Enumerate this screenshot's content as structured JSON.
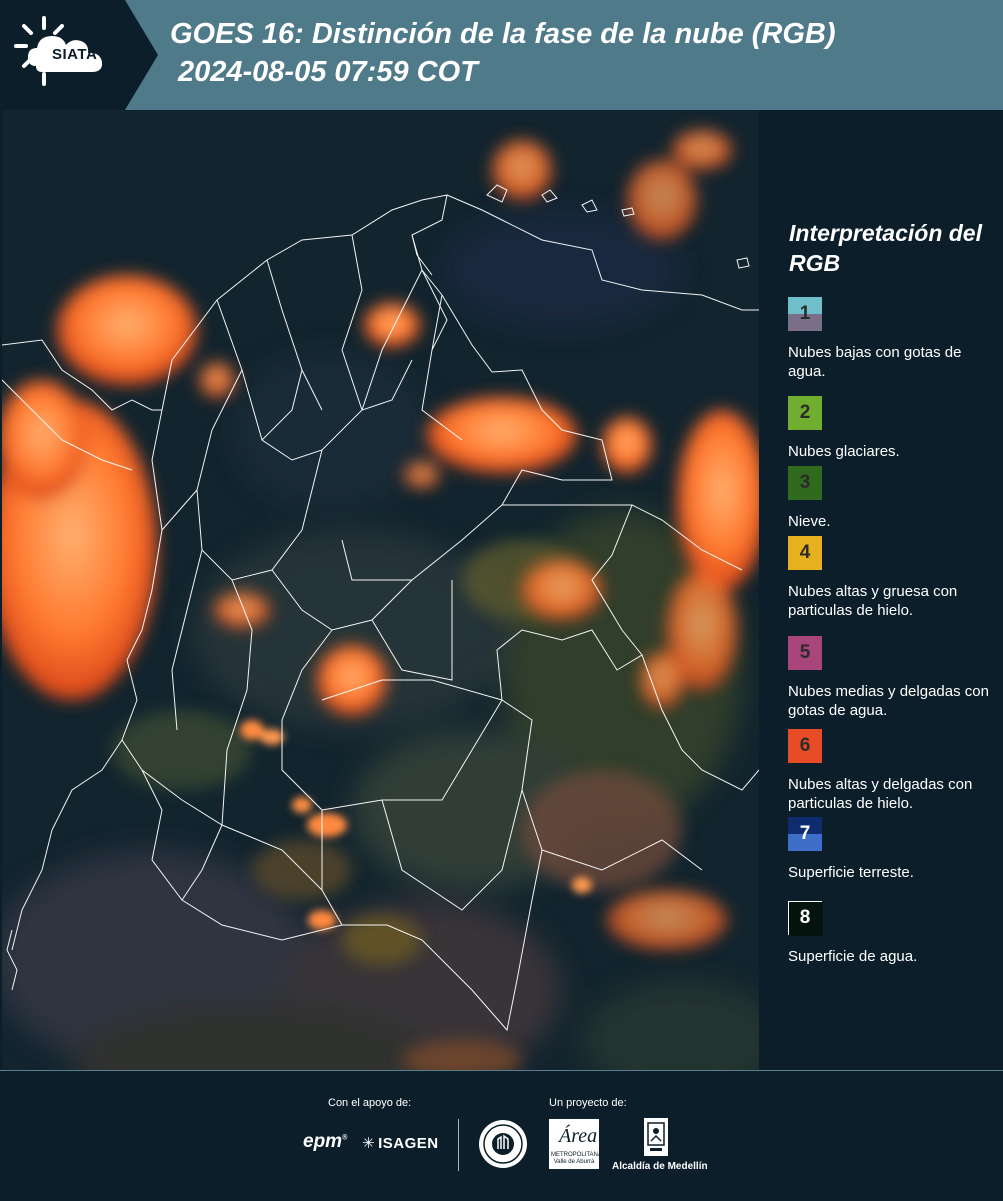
{
  "header": {
    "logo_text": "SIATA",
    "title": "GOES 16: Distinción de la fase de la nube (RGB)",
    "subtitle": "2024-08-05 07:59 COT"
  },
  "map": {
    "icon": "satellite-rgb-map",
    "colors": {
      "background": "#12242e",
      "warm_cloud": "#ff7a30",
      "warm_cloud_light": "#ffb070",
      "boundary": "#ffffff"
    }
  },
  "legend": {
    "title": "Interpretación del RGB",
    "items": [
      {
        "num": "1",
        "label": "Nubes bajas con gotas de agua.",
        "color_top": "#6fbfcb",
        "color_bottom": "#7b6e88"
      },
      {
        "num": "2",
        "label": "Nubes glaciares.",
        "color_top": "#6fae2f",
        "color_bottom": "#6fae2f"
      },
      {
        "num": "3",
        "label": "Nieve.",
        "color_top": "#2f6a1f",
        "color_bottom": "#2f6a1f"
      },
      {
        "num": "4",
        "label": "Nubes altas y gruesa con particulas de hielo.",
        "color_top": "#e6b01e",
        "color_bottom": "#e6b01e"
      },
      {
        "num": "5",
        "label": "Nubes medias y delgadas con gotas de agua.",
        "color_top": "#a8467c",
        "color_bottom": "#a8467c"
      },
      {
        "num": "6",
        "label": "Nubes altas y delgadas con particulas de hielo.",
        "color_top": "#e84c27",
        "color_bottom": "#e84c27"
      },
      {
        "num": "7",
        "label": "Superficie terreste.",
        "color_top": "#0e2c6e",
        "color_bottom": "#3f6ec8"
      },
      {
        "num": "8",
        "label": "Superficie de agua.",
        "color_top": "#061410",
        "color_bottom": "#061410"
      }
    ]
  },
  "footer": {
    "support_label": "Con el apoyo de:",
    "project_label": "Un proyecto de:",
    "epm": "epm",
    "isagen": "ISAGEN",
    "amva_main": "Área",
    "amva_sub": "METROPOLITANA Valle de Aburrá",
    "alcaldia": "Alcaldía de Medellín"
  }
}
